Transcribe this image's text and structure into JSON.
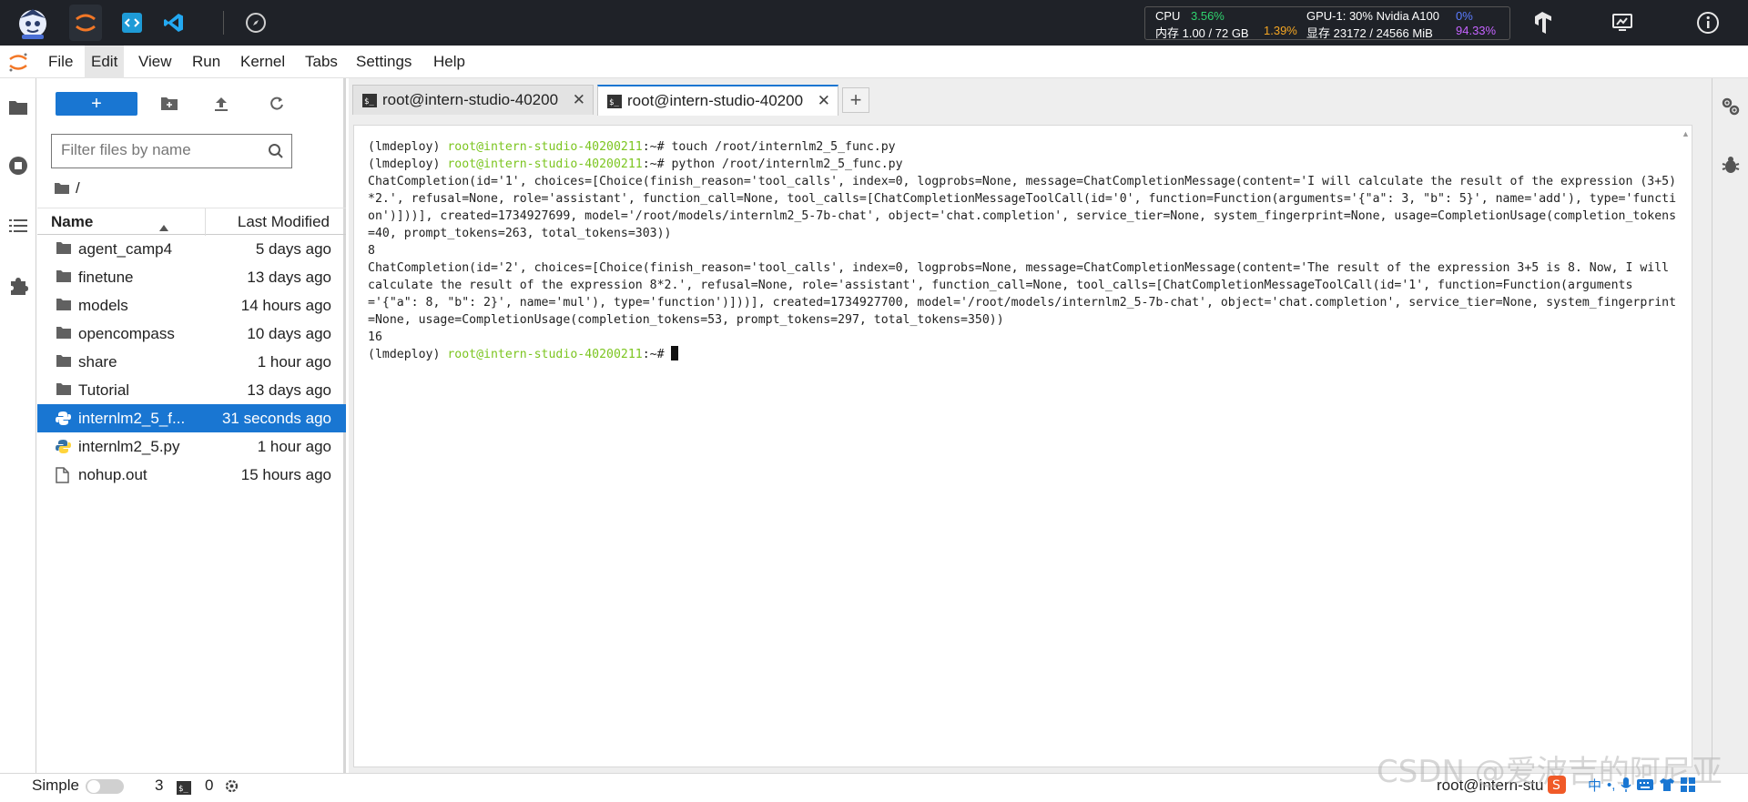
{
  "topbar": {
    "cpu_label": "CPU",
    "cpu_value": "3.56%",
    "mem_label": "内存 1.00 / 72 GB",
    "mem_value": "1.39%",
    "gpu_label": "GPU-1: 30% Nvidia A100",
    "gpu_value": "0%",
    "vram_label": "显存 23172 / 24566 MiB",
    "vram_value": "94.33%"
  },
  "menu": {
    "items": [
      "File",
      "Edit",
      "View",
      "Run",
      "Kernel",
      "Tabs",
      "Settings",
      "Help"
    ]
  },
  "filebrowser": {
    "new_label": "+",
    "search_placeholder": "Filter files by name",
    "breadcrumb": "/",
    "col_name": "Name",
    "col_modified": "Last Modified",
    "files": [
      {
        "name": "agent_camp4",
        "modified": "5 days ago",
        "type": "folder"
      },
      {
        "name": "finetune",
        "modified": "13 days ago",
        "type": "folder"
      },
      {
        "name": "models",
        "modified": "14 hours ago",
        "type": "folder"
      },
      {
        "name": "opencompass",
        "modified": "10 days ago",
        "type": "folder"
      },
      {
        "name": "share",
        "modified": "1 hour ago",
        "type": "folder"
      },
      {
        "name": "Tutorial",
        "modified": "13 days ago",
        "type": "folder"
      },
      {
        "name": "internlm2_5_f...",
        "modified": "31 seconds ago",
        "type": "python",
        "selected": true
      },
      {
        "name": "internlm2_5.py",
        "modified": "1 hour ago",
        "type": "python"
      },
      {
        "name": "nohup.out",
        "modified": "15 hours ago",
        "type": "file"
      }
    ]
  },
  "tabs": [
    {
      "label": "root@intern-studio-40200",
      "close": "✕"
    },
    {
      "label": "root@intern-studio-40200",
      "close": "✕"
    }
  ],
  "tab_add": "+",
  "terminal": {
    "lines": [
      {
        "prefix": "(lmdeploy) ",
        "host": "root@intern-studio-40200211",
        "rest": ":~# touch /root/internlm2_5_func.py"
      },
      {
        "prefix": "(lmdeploy) ",
        "host": "root@intern-studio-40200211",
        "rest": ":~# python /root/internlm2_5_func.py"
      },
      {
        "text": "ChatCompletion(id='1', choices=[Choice(finish_reason='tool_calls', index=0, logprobs=None, message=ChatCompletionMessage(content='I will calculate the result of the expression (3+5)*2.', refusal=None, role='assistant', function_call=None, tool_calls=[ChatCompletionMessageToolCall(id='0', function=Function(arguments='{\"a\": 3, \"b\": 5}', name='add'), type='function')]))], created=1734927699, model='/root/models/internlm2_5-7b-chat', object='chat.completion', service_tier=None, system_fingerprint=None, usage=CompletionUsage(completion_tokens=40, prompt_tokens=263, total_tokens=303))"
      },
      {
        "text": "8"
      },
      {
        "text": "ChatCompletion(id='2', choices=[Choice(finish_reason='tool_calls', index=0, logprobs=None, message=ChatCompletionMessage(content='The result of the expression 3+5 is 8. Now, I will calculate the result of the expression 8*2.', refusal=None, role='assistant', function_call=None, tool_calls=[ChatCompletionMessageToolCall(id='1', function=Function(arguments='{\"a\": 8, \"b\": 2}', name='mul'), type='function')]))], created=1734927700, model='/root/models/internlm2_5-7b-chat', object='chat.completion', service_tier=None, system_fingerprint=None, usage=CompletionUsage(completion_tokens=53, prompt_tokens=297, total_tokens=350))"
      },
      {
        "text": "16"
      },
      {
        "prefix": "(lmdeploy) ",
        "host": "root@intern-studio-40200211",
        "rest": ":~# ",
        "cursor": true
      }
    ]
  },
  "statusbar": {
    "mode_label": "Simple",
    "terminals_count": "3",
    "kernels_count": "0",
    "user": "root@intern-stu"
  },
  "watermark": "CSDN @爱波吉的阿尼亚",
  "colors": {
    "accent": "#1976d2",
    "host_green": "#7cc520",
    "topbar_bg": "#1f2228"
  }
}
